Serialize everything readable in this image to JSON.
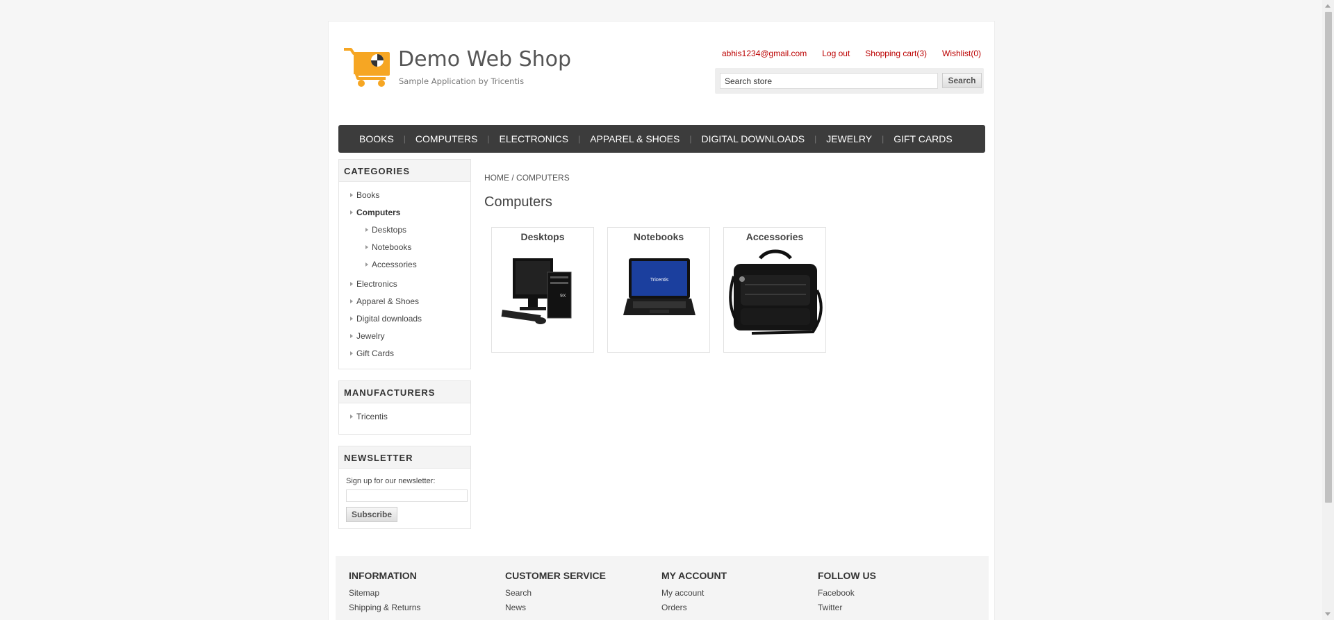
{
  "header": {
    "title": "Demo Web Shop",
    "subtitle": "Sample Application by Tricentis",
    "links": {
      "account": "abhis1234@gmail.com",
      "logout": "Log out",
      "cart": "Shopping cart(3)",
      "wishlist": "Wishlist(0)"
    },
    "search": {
      "value": "Search store",
      "button": "Search"
    }
  },
  "menu": [
    "BOOKS",
    "COMPUTERS",
    "ELECTRONICS",
    "APPAREL & SHOES",
    "DIGITAL DOWNLOADS",
    "JEWELRY",
    "GIFT CARDS"
  ],
  "categories": {
    "title": "CATEGORIES",
    "items": [
      "Books",
      "Computers",
      "Desktops",
      "Notebooks",
      "Accessories",
      "Electronics",
      "Apparel & Shoes",
      "Digital downloads",
      "Jewelry",
      "Gift Cards"
    ]
  },
  "manufacturers": {
    "title": "MANUFACTURERS",
    "items": [
      "Tricentis"
    ]
  },
  "newsletter": {
    "title": "NEWSLETTER",
    "label": "Sign up for our newsletter:",
    "value": "",
    "button": "Subscribe"
  },
  "breadcrumb": {
    "home": "HOME",
    "separator": "/",
    "current": "COMPUTERS"
  },
  "main": {
    "title": "Computers",
    "subcategories": [
      "Desktops",
      "Notebooks",
      "Accessories"
    ],
    "notebook_screen_text": "Tricentis"
  },
  "footer": {
    "information": {
      "title": "INFORMATION",
      "items": [
        "Sitemap",
        "Shipping & Returns"
      ]
    },
    "customer_service": {
      "title": "CUSTOMER SERVICE",
      "items": [
        "Search",
        "News"
      ]
    },
    "my_account": {
      "title": "MY ACCOUNT",
      "items": [
        "My account",
        "Orders"
      ]
    },
    "follow_us": {
      "title": "FOLLOW US",
      "items": [
        "Facebook",
        "Twitter"
      ]
    }
  },
  "colors": {
    "link_red": "#bb0000",
    "menu_bg": "#3c3c3c",
    "logo_orange": "#f6a623"
  },
  "icons": [
    "cart-logo-icon",
    "triangle-bullet-icon"
  ]
}
